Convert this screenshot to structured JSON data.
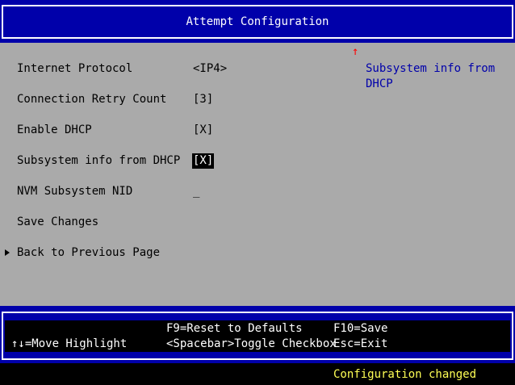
{
  "title": "Attempt Configuration",
  "menu": [
    {
      "label": "Internet Protocol",
      "value": "<IP4>"
    },
    {
      "label": "Connection Retry Count",
      "value": "[3]"
    },
    {
      "label": "Enable DHCP",
      "value": "[X]"
    },
    {
      "label": "Subsystem info from DHCP",
      "value": "[X]"
    },
    {
      "label": "NVM Subsystem NID",
      "value": "_"
    },
    {
      "label": "Save Changes"
    },
    {
      "label": "Back to Previous Page"
    }
  ],
  "help": {
    "arrow": "↑",
    "text": "Subsystem info from DHCP"
  },
  "footer": {
    "move_highlight": "↑↓=Move Highlight",
    "reset_defaults": "F9=Reset to Defaults",
    "toggle_checkbox": "<Spacebar>Toggle Checkbox",
    "save": "F10=Save",
    "exit": "Esc=Exit"
  },
  "status": "Configuration changed",
  "colors": {
    "title_bar": "#0000aa",
    "content_bg": "#aaaaaa",
    "help_text": "#0000aa",
    "help_arrow": "#ff0000",
    "status_text": "#ffff55"
  }
}
